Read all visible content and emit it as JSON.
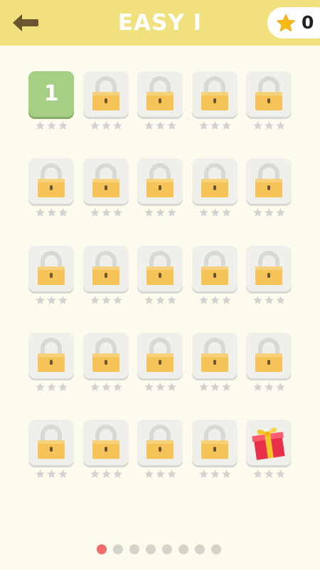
{
  "header": {
    "title": "EASY I",
    "star_count": "0",
    "back_icon": "back-arrow-icon",
    "star_icon": "star-icon",
    "background_color": "#f0e07e"
  },
  "levels": [
    {
      "state": "unlocked",
      "label": "1",
      "stars_earned": 0
    },
    {
      "state": "locked",
      "stars_earned": 0
    },
    {
      "state": "locked",
      "stars_earned": 0
    },
    {
      "state": "locked",
      "stars_earned": 0
    },
    {
      "state": "locked",
      "stars_earned": 0
    },
    {
      "state": "locked",
      "stars_earned": 0
    },
    {
      "state": "locked",
      "stars_earned": 0
    },
    {
      "state": "locked",
      "stars_earned": 0
    },
    {
      "state": "locked",
      "stars_earned": 0
    },
    {
      "state": "locked",
      "stars_earned": 0
    },
    {
      "state": "locked",
      "stars_earned": 0
    },
    {
      "state": "locked",
      "stars_earned": 0
    },
    {
      "state": "locked",
      "stars_earned": 0
    },
    {
      "state": "locked",
      "stars_earned": 0
    },
    {
      "state": "locked",
      "stars_earned": 0
    },
    {
      "state": "locked",
      "stars_earned": 0
    },
    {
      "state": "locked",
      "stars_earned": 0
    },
    {
      "state": "locked",
      "stars_earned": 0
    },
    {
      "state": "locked",
      "stars_earned": 0
    },
    {
      "state": "locked",
      "stars_earned": 0
    },
    {
      "state": "locked",
      "stars_earned": 0
    },
    {
      "state": "locked",
      "stars_earned": 0
    },
    {
      "state": "locked",
      "stars_earned": 0
    },
    {
      "state": "locked",
      "stars_earned": 0
    },
    {
      "state": "gift",
      "stars_earned": 0
    }
  ],
  "pagination": {
    "total_pages": 8,
    "current_page": 1
  },
  "colors": {
    "background": "#fcfbee",
    "unlocked_tile": "#a6cf86",
    "locked_tile": "#efefec",
    "lock_body": "#f5c358",
    "star_empty": "#d2d2d2",
    "page_dot_active": "#f26b6b",
    "page_dot_inactive": "#d4d4ca"
  }
}
